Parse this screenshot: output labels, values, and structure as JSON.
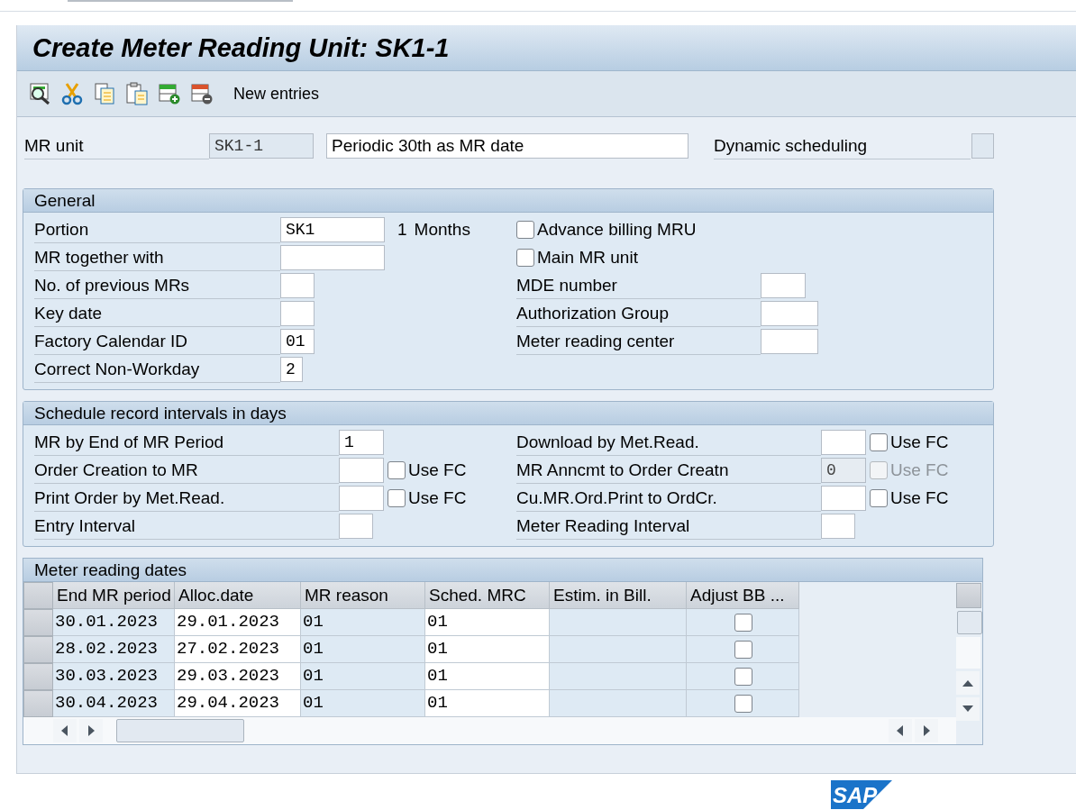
{
  "window": {
    "title": "Create Meter Reading Unit: SK1-1"
  },
  "toolbar": {
    "button_label": "New entries"
  },
  "header": {
    "mr_unit_label": "MR unit",
    "mr_unit_value": "SK1-1",
    "description": "Periodic 30th as MR date",
    "dynamic_label": "Dynamic scheduling",
    "dynamic_checked": false
  },
  "general": {
    "title": "General",
    "left": [
      {
        "label": "Portion",
        "value": "SK1",
        "suffix_number": "1",
        "suffix_unit": "Months"
      },
      {
        "label": "MR together with"
      },
      {
        "label": "No. of previous MRs"
      },
      {
        "label": "Key date"
      },
      {
        "label": "Factory Calendar ID",
        "value": "01"
      },
      {
        "label": "Correct Non-Workday",
        "value": "2"
      }
    ],
    "right": [
      {
        "kind": "checkbox",
        "label": "Advance billing MRU",
        "checked": false
      },
      {
        "kind": "checkbox",
        "label": "Main MR unit",
        "checked": false
      },
      {
        "kind": "field",
        "label": "MDE number"
      },
      {
        "kind": "field",
        "label": "Authorization Group"
      },
      {
        "kind": "field",
        "label": "Meter reading center"
      }
    ]
  },
  "schedule": {
    "title": "Schedule record intervals in days",
    "left": [
      {
        "label": "MR by End of MR Period",
        "value": "1"
      },
      {
        "label": "Order Creation to MR",
        "use_fc": {
          "label": "Use FC",
          "checked": false,
          "disabled": false
        }
      },
      {
        "label": "Print Order by Met.Read.",
        "use_fc": {
          "label": "Use FC",
          "checked": false,
          "disabled": false
        }
      },
      {
        "label": "Entry Interval"
      }
    ],
    "right": [
      {
        "label": "Download by Met.Read.",
        "use_fc": {
          "label": "Use FC",
          "checked": false,
          "disabled": false
        }
      },
      {
        "label": "MR Anncmt to Order Creatn",
        "value": "0",
        "disabled": true,
        "use_fc": {
          "label": "Use FC",
          "checked": false,
          "disabled": true
        }
      },
      {
        "label": "Cu.MR.Ord.Print to OrdCr.",
        "use_fc": {
          "label": "Use FC",
          "checked": false,
          "disabled": false
        }
      },
      {
        "label": "Meter Reading Interval"
      }
    ]
  },
  "table": {
    "title": "Meter reading dates",
    "columns": [
      "End MR period",
      "Alloc.date",
      "MR reason",
      "Sched. MRC",
      "Estim. in Bill.",
      "Adjust BB ..."
    ],
    "rows": [
      {
        "end_mr_period": "30.01.2023",
        "alloc_date": "29.01.2023",
        "mr_reason": "01",
        "sched_mrc": "01",
        "adjust_bb": false
      },
      {
        "end_mr_period": "28.02.2023",
        "alloc_date": "27.02.2023",
        "mr_reason": "01",
        "sched_mrc": "01",
        "adjust_bb": false
      },
      {
        "end_mr_period": "30.03.2023",
        "alloc_date": "29.03.2023",
        "mr_reason": "01",
        "sched_mrc": "01",
        "adjust_bb": false
      },
      {
        "end_mr_period": "30.04.2023",
        "alloc_date": "29.04.2023",
        "mr_reason": "01",
        "sched_mrc": "01",
        "adjust_bb": false
      }
    ]
  },
  "footer": {
    "logo_text": "SAP"
  }
}
